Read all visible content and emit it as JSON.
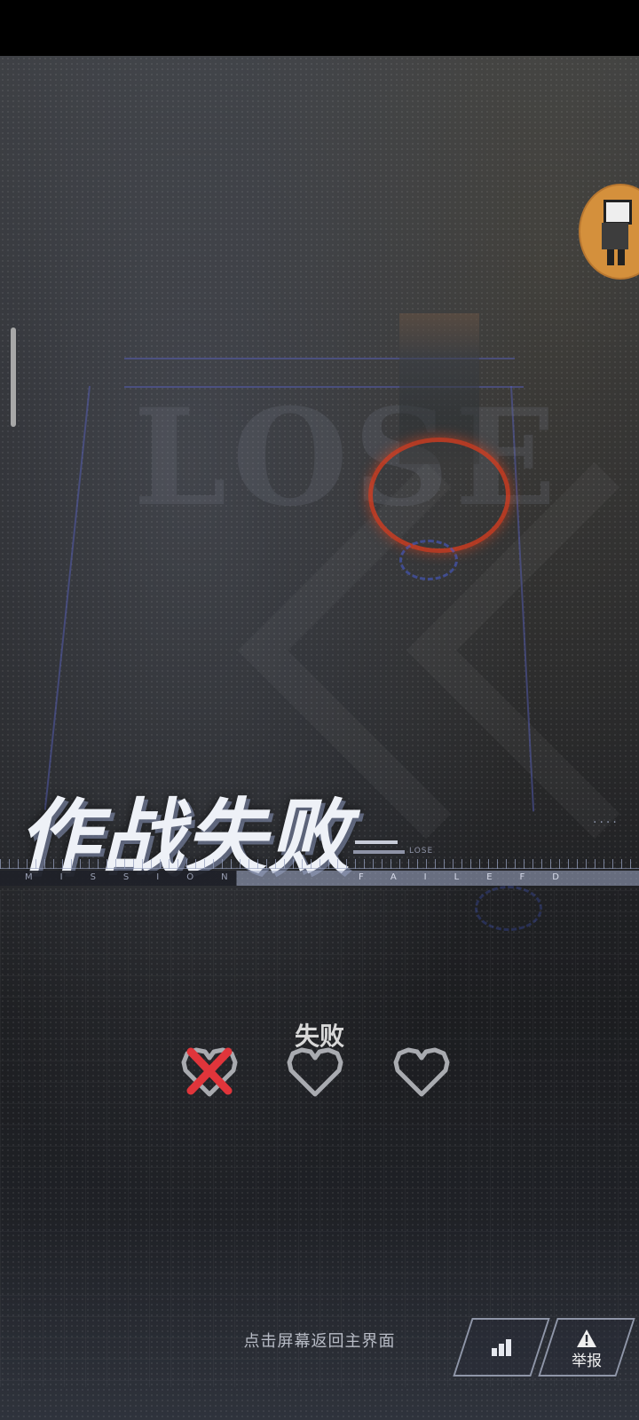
{
  "background": {
    "watermark_text": "LOSE"
  },
  "result": {
    "title": "作战失败",
    "small_tag": "LOSE",
    "dots": "....",
    "banner_left": "MISSION",
    "banner_right": "FAILEFD",
    "status_label": "失败",
    "lives": [
      {
        "state": "lost",
        "icon": "crossed-heart-icon"
      },
      {
        "state": "empty",
        "icon": "heart-outline-icon"
      },
      {
        "state": "empty",
        "icon": "heart-outline-icon"
      }
    ]
  },
  "footer": {
    "hint": "点击屏幕返回主界面",
    "stats_icon": "bar-chart-icon",
    "report_label": "举报",
    "report_icon": "warning-icon"
  },
  "colors": {
    "cross": "#e0353b",
    "heart_outline": "#a9abb0",
    "button_border": "#8f96a8"
  }
}
